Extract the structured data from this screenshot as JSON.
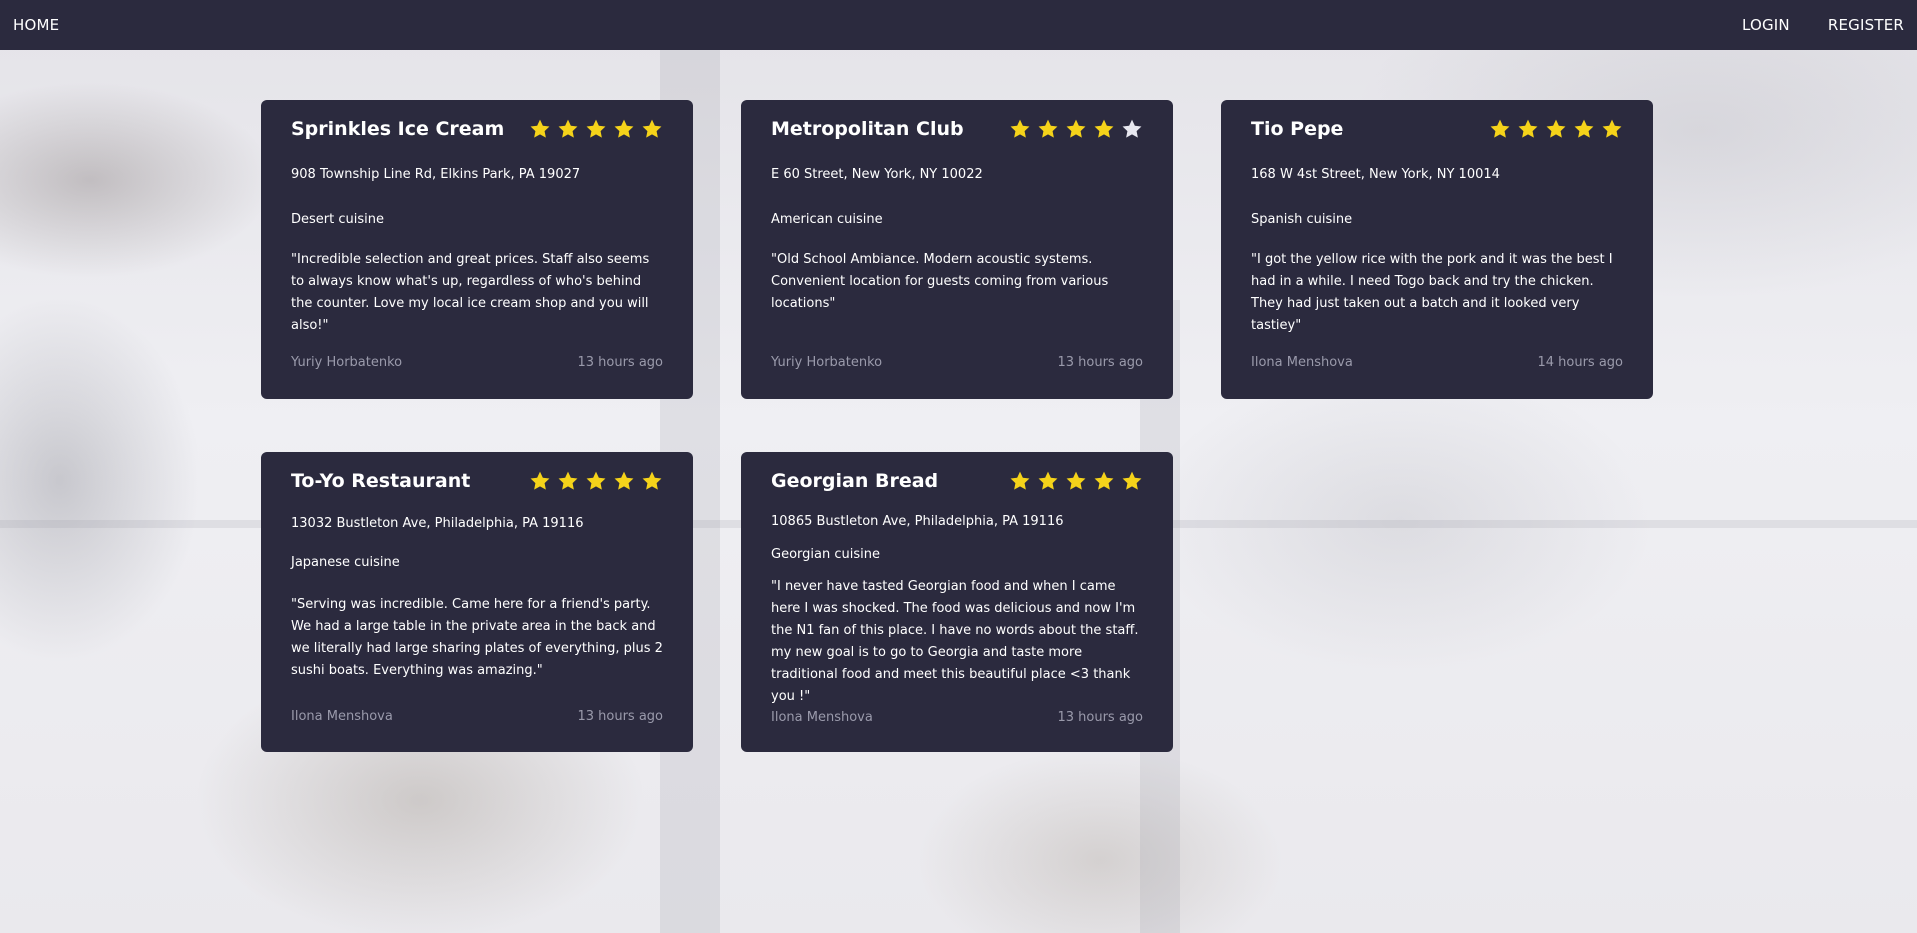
{
  "nav": {
    "home": "HOME",
    "login": "LOGIN",
    "register": "REGISTER"
  },
  "colors": {
    "navbar": "#2b2a3e",
    "card": "#2b2a3e",
    "star_on": "#f5d31a",
    "star_off": "#e8e8f0"
  },
  "cards": [
    {
      "title": "Sprinkles Ice Cream",
      "rating": 5,
      "address": "908 Township Line Rd, Elkins Park, PA 19027",
      "cuisine": "Desert cuisine",
      "review": "\"Incredible selection and great prices. Staff also seems to always know what's up, regardless of who's behind the counter. Love my local ice cream shop and you will also!\"",
      "author": "Yuriy Horbatenko",
      "time": "13 hours ago"
    },
    {
      "title": "Metropolitan Club",
      "rating": 4,
      "address": "E 60 Street, New York, NY 10022",
      "cuisine": "American cuisine",
      "review": "\"Old School Ambiance. Modern acoustic systems. Convenient location for guests coming from various locations\"",
      "author": "Yuriy Horbatenko",
      "time": "13 hours ago"
    },
    {
      "title": "Tio Pepe",
      "rating": 5,
      "address": "168 W 4st Street, New York, NY 10014",
      "cuisine": "Spanish cuisine",
      "review": "\"I got the yellow rice with the pork and it was the best I had in a while. I need Togo back and try the chicken. They had just taken out a batch and it looked very tastiey\"",
      "author": "Ilona Menshova",
      "time": "14 hours ago"
    },
    {
      "title": "To-Yo Restaurant",
      "rating": 5,
      "address": "13032 Bustleton Ave, Philadelphia, PA 19116",
      "cuisine": "Japanese cuisine",
      "review": "\"Serving was incredible. Came here for a friend's party. We had a large table in the private area in the back and we literally had large sharing plates of everything, plus 2 sushi boats. Everything was amazing.\"",
      "author": "Ilona Menshova",
      "time": "13 hours ago"
    },
    {
      "title": "Georgian Bread",
      "rating": 5,
      "address": "10865 Bustleton Ave, Philadelphia, PA 19116",
      "cuisine": "Georgian cuisine",
      "review": "\"I never have tasted Georgian food and when I came here I was shocked. The food was delicious and now I'm the N1 fan of this place. I have no words about the staff. my new goal is to go to Georgia and taste more traditional food and meet this beautiful place <3 thank you !\"",
      "author": "Ilona Menshova",
      "time": "13 hours ago"
    }
  ]
}
